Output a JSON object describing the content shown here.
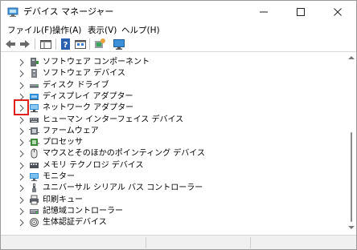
{
  "window": {
    "title": "デバイス マネージャー"
  },
  "menu": {
    "file": "ファイル(F)",
    "action": "操作(A)",
    "view": "表示(V)",
    "help": "ヘルプ(H)"
  },
  "toolbar": {
    "icons": [
      "back-arrow-icon",
      "forward-arrow-icon",
      "properties-icon",
      "help-icon",
      "show-hidden-icon",
      "scan-hardware-icon",
      "monitor-icon"
    ]
  },
  "tree": {
    "items": [
      {
        "label": "ソフトウェア コンポーネント",
        "icon": "software-component-icon"
      },
      {
        "label": "ソフトウェア デバイス",
        "icon": "software-device-icon"
      },
      {
        "label": "ディスク ドライブ",
        "icon": "disk-drive-icon"
      },
      {
        "label": "ディスプレイ アダプター",
        "icon": "display-adapter-icon"
      },
      {
        "label": "ネットワーク アダプター",
        "icon": "network-adapter-icon"
      },
      {
        "label": "ヒューマン インターフェイス デバイス",
        "icon": "hid-icon"
      },
      {
        "label": "ファームウェア",
        "icon": "firmware-icon"
      },
      {
        "label": "プロセッサ",
        "icon": "processor-icon"
      },
      {
        "label": "マウスとそのほかのポインティング デバイス",
        "icon": "mouse-icon"
      },
      {
        "label": "メモリ テクノロジ デバイス",
        "icon": "memory-device-icon"
      },
      {
        "label": "モニター",
        "icon": "monitor-icon"
      },
      {
        "label": "ユニバーサル シリアル バス コントローラー",
        "icon": "usb-icon"
      },
      {
        "label": "印刷キュー",
        "icon": "printer-icon"
      },
      {
        "label": "記憶域コントローラー",
        "icon": "storage-controller-icon"
      },
      {
        "label": "生体認証デバイス",
        "icon": "biometric-icon"
      }
    ],
    "highlighted_index": 4
  },
  "colors": {
    "highlight_box": "#e0201c",
    "accent_blue": "#1e78d7"
  }
}
